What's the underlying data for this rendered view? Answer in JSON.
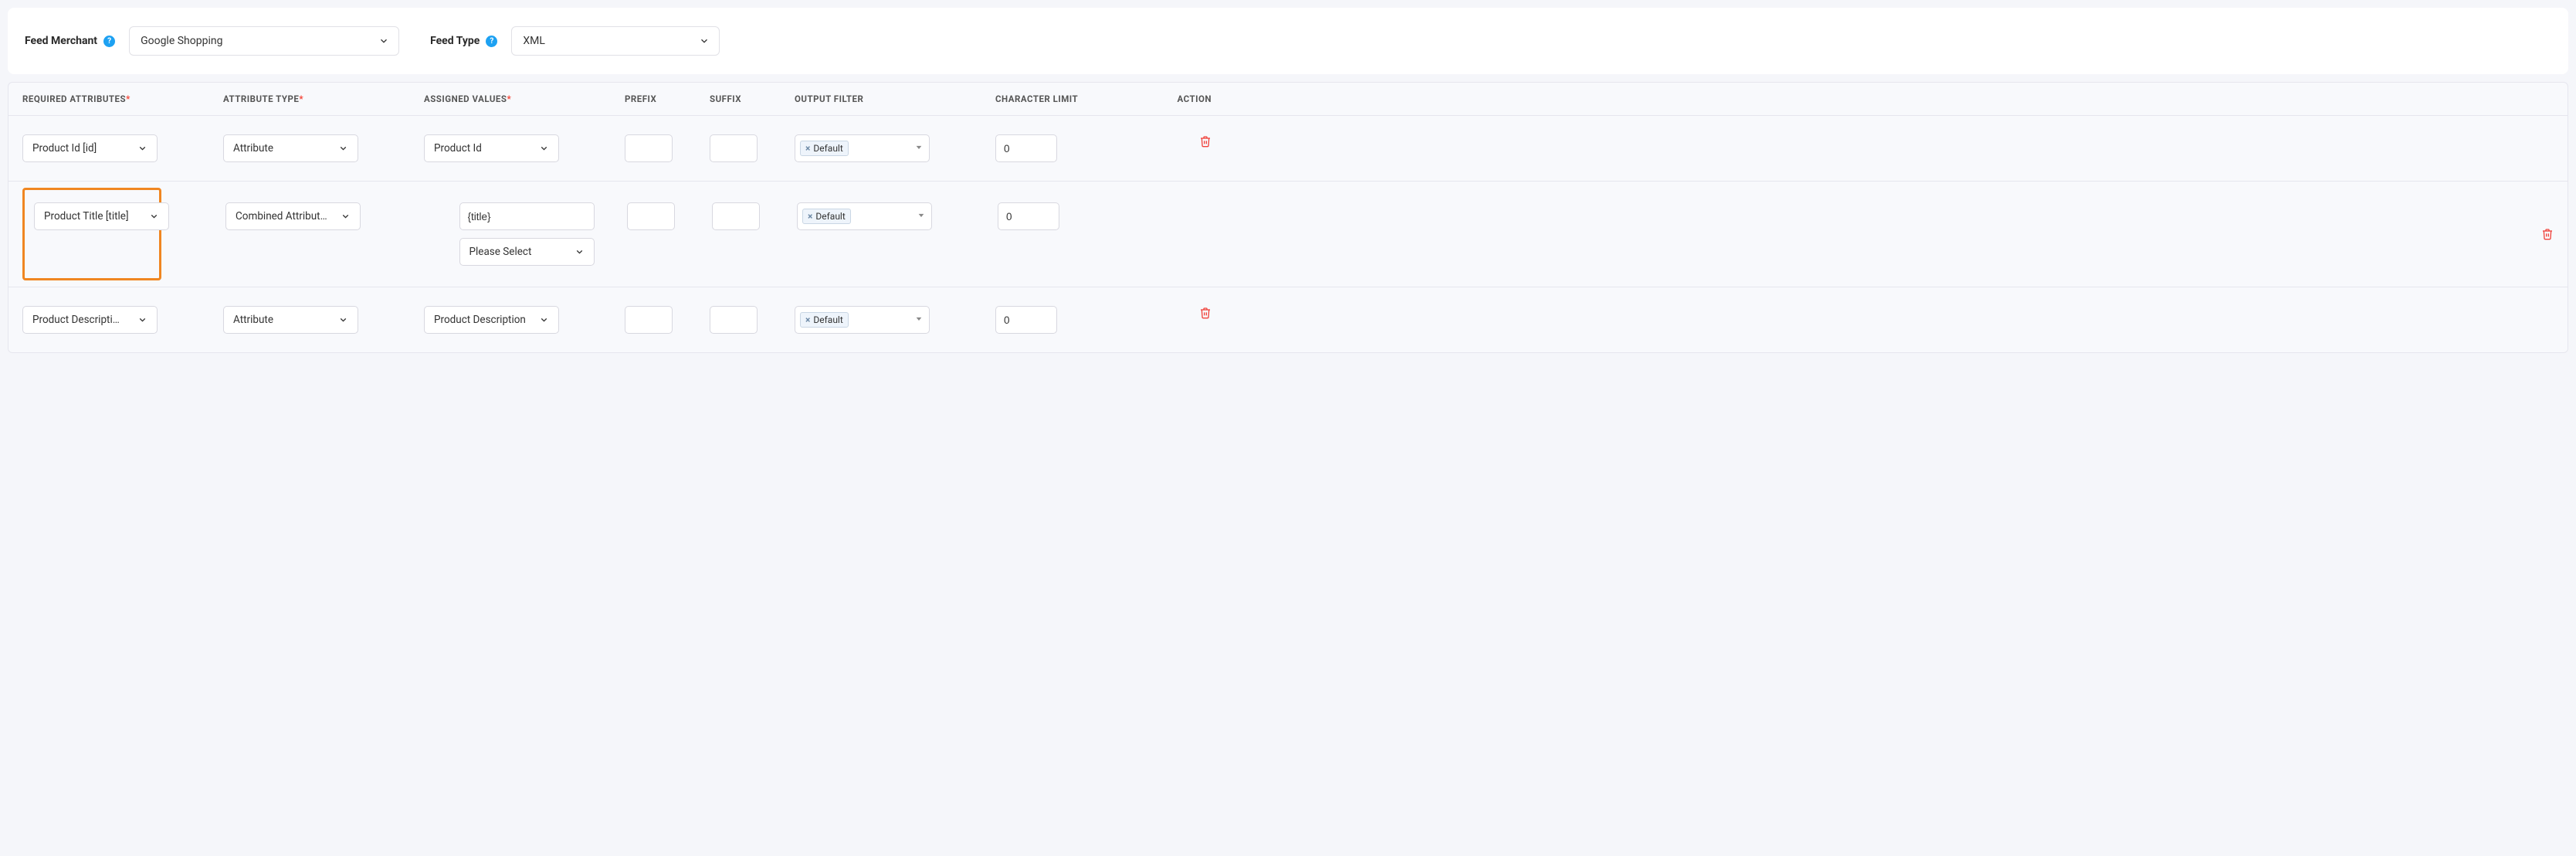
{
  "top": {
    "feed_merchant_label": "Feed Merchant",
    "feed_merchant_value": "Google Shopping",
    "feed_type_label": "Feed Type",
    "feed_type_value": "XML"
  },
  "headers": {
    "required_attributes": "REQUIRED ATTRIBUTES",
    "attribute_type": "ATTRIBUTE TYPE",
    "assigned_values": "ASSIGNED VALUES",
    "prefix": "PREFIX",
    "suffix": "SUFFIX",
    "output_filter": "OUTPUT FILTER",
    "character_limit": "CHARACTER LIMIT",
    "action": "ACTION",
    "required_mark": "*"
  },
  "rows": [
    {
      "required_attribute": "Product Id [id]",
      "attribute_type": "Attribute",
      "assigned_value": "Product Id",
      "assigned_mode": "select",
      "prefix": "",
      "suffix": "",
      "output_filter_tag": "Default",
      "character_limit": "0",
      "highlighted": false
    },
    {
      "required_attribute": "Product Title [title]",
      "attribute_type": "Combined Attributes",
      "assigned_value": "{title}",
      "assigned_mode": "combined",
      "assigned_secondary": "Please Select",
      "prefix": "",
      "suffix": "",
      "output_filter_tag": "Default",
      "character_limit": "0",
      "highlighted": true
    },
    {
      "required_attribute": "Product Description [description]",
      "attribute_type": "Attribute",
      "assigned_value": "Product Description",
      "assigned_mode": "select",
      "prefix": "",
      "suffix": "",
      "output_filter_tag": "Default",
      "character_limit": "0",
      "highlighted": false
    }
  ]
}
